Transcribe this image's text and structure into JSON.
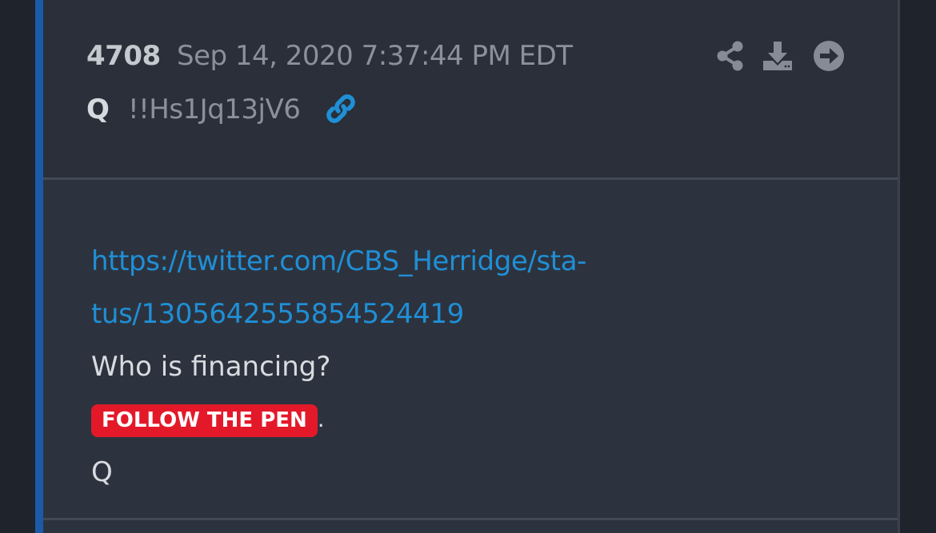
{
  "post": {
    "number": "4708",
    "timestamp": "Sep 14, 2020 7:37:44 PM EDT",
    "author": "Q",
    "tripcode": "!!Hs1Jq13jV6"
  },
  "actions": {
    "share_icon": "share-icon",
    "download_icon": "download-icon",
    "open_icon": "arrow-circle-right-icon",
    "link_icon": "chain-link-icon"
  },
  "content": {
    "link_line1": "https://twitter.com/CBS_Herridge/sta-",
    "link_line2": "tus/1305642555854524419",
    "question": "Who is financing?",
    "highlight": "FOLLOW THE PEN",
    "highlight_suffix": ".",
    "signature": "Q"
  },
  "colors": {
    "accent_bar": "#1a5aa8",
    "link": "#1f8fd6",
    "highlight_bg": "#e3192a",
    "card_bg": "#2d333e",
    "header_bg": "#2a2f39"
  }
}
